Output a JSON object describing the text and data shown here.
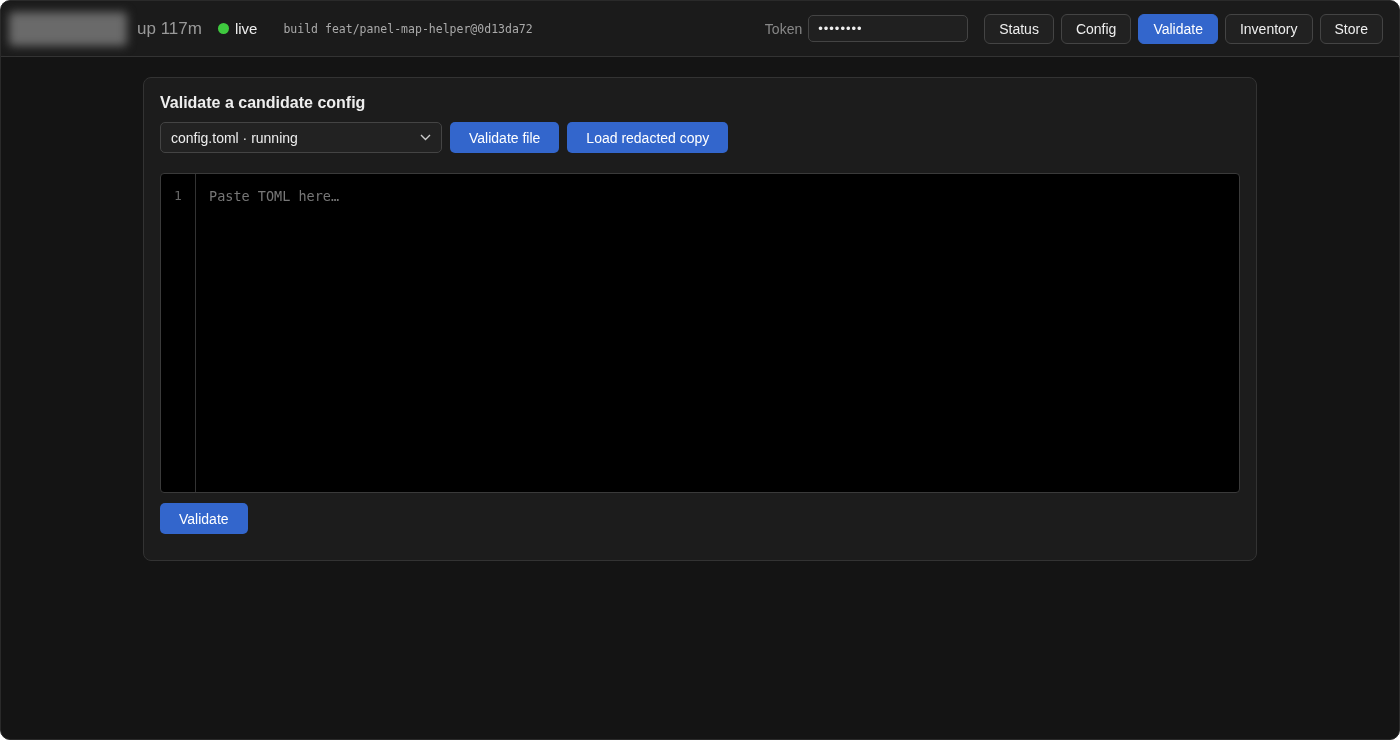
{
  "header": {
    "uptime": "up 117m",
    "status": {
      "label": "live",
      "color": "#3fc93f"
    },
    "build": "build feat/panel-map-helper@0d13da72",
    "token": {
      "label": "Token",
      "value": "••••••••"
    },
    "nav": [
      {
        "label": "Status",
        "selected": false
      },
      {
        "label": "Config",
        "selected": false
      },
      {
        "label": "Validate",
        "selected": true
      },
      {
        "label": "Inventory",
        "selected": false
      },
      {
        "label": "Store",
        "selected": false
      }
    ]
  },
  "panel": {
    "title": "Validate a candidate config",
    "file_select": "config.toml · running",
    "actions": [
      "Validate file",
      "Load redacted copy"
    ],
    "editor": {
      "line_numbers": [
        "1"
      ],
      "placeholder": "Paste TOML here…"
    },
    "submit": "Validate"
  }
}
